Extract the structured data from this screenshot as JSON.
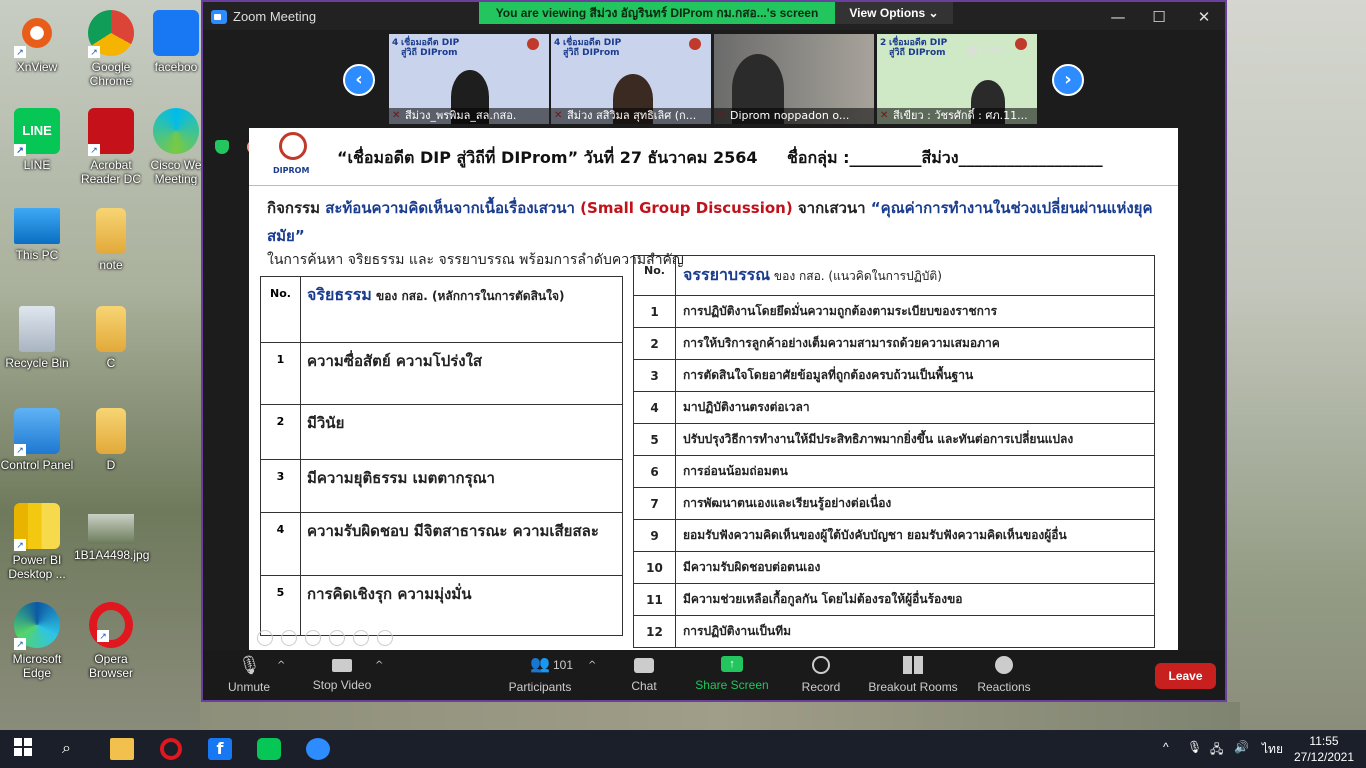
{
  "desktop": {
    "icons": [
      {
        "label": "XnView"
      },
      {
        "label": "Google Chrome"
      },
      {
        "label": "faceboo"
      },
      {
        "label": "LINE"
      },
      {
        "label": "Acrobat Reader DC"
      },
      {
        "label": "Cisco We Meeting"
      },
      {
        "label": "This PC"
      },
      {
        "label": "note"
      },
      {
        "label": "Recycle Bin"
      },
      {
        "label": "C"
      },
      {
        "label": "Control Panel"
      },
      {
        "label": "D"
      },
      {
        "label": "Power BI Desktop ..."
      },
      {
        "label": "1B1A4498.jpg"
      },
      {
        "label": "Microsoft Edge"
      },
      {
        "label": "Opera Browser"
      }
    ]
  },
  "zoom": {
    "window_title": "Zoom Meeting",
    "viewing_banner": "You are viewing สีม่วง อัญรินทร์ DIProm กม.กสอ...'s screen",
    "view_options": "View Options",
    "view_label": "View",
    "tiles": [
      {
        "name": "สีม่วง_พรพิมล_สล.กสอ.",
        "banner_num": "4",
        "banner": "เชื่อมอดีต DIP สู่วิถี DIProm"
      },
      {
        "name": "สีม่วง สสิวิมล สุทธิเลิศ (ก...",
        "banner_num": "4",
        "banner": "เชื่อมอดีต DIP สู่วิถี DIProm"
      },
      {
        "name": "Diprom noppadon o...",
        "banner_num": "",
        "banner": ""
      },
      {
        "name": "สีเขียว : วัชรศักดิ์ : ศภ.11...",
        "banner_num": "2",
        "banner": "เชื่อมอดีต DIP สู่วิถี DIProm"
      }
    ],
    "controls": {
      "unmute": "Unmute",
      "stop_video": "Stop Video",
      "participants": "Participants",
      "participants_count": "101",
      "chat": "Chat",
      "share_screen": "Share Screen",
      "record": "Record",
      "breakout_rooms": "Breakout Rooms",
      "reactions": "Reactions",
      "leave": "Leave"
    }
  },
  "slide": {
    "logo_text": "DIPROM",
    "title": "“เชื่อมอดีต DIP สู่วิถีที่ DIProm” วันที่ 27 ธันวาคม 2564",
    "group_label": "ชื่อกลุ่ม :_________สีม่วง__________________",
    "activity_prefix": "กิจกรรม",
    "activity_main": " สะท้อนความคิดเห็นจากเนื้อเรื่องเสวนา ",
    "activity_red": "(Small Group Discussion)",
    "activity_from": "  จากเสวนา ",
    "activity_topic": "“คุณค่าการทำงานในช่วงเปลี่ยนผ่านแห่งยุคสมัย”",
    "subtext": "ในการค้นหา จริยธรรม และ จรรยาบรรณ พร้อมการลำดับความสำคัญ",
    "ethics_table": {
      "no_header": "No.",
      "head_main": "จริยธรรม",
      "head_sub": " ของ กสอ. (หลักการในการตัดสินใจ)",
      "rows": [
        {
          "no": "1",
          "text": "ความซื่อสัตย์ ความโปร่งใส"
        },
        {
          "no": "2",
          "text": "มีวินัย"
        },
        {
          "no": "3",
          "text": "มีความยุติธรรม เมตตากรุณา"
        },
        {
          "no": "4",
          "text": "ความรับผิดชอบ มีจิตสาธารณะ ความเสียสละ"
        },
        {
          "no": "5",
          "text": "การคิดเชิงรุก ความมุ่งมั่น"
        }
      ]
    },
    "code_table": {
      "no_header": "No.",
      "head_main": "จรรยาบรรณ",
      "head_sub": " ของ กสอ. (แนวคิดในการปฏิบัติ)",
      "rows": [
        {
          "no": "1",
          "text": "การปฏิบัติงานโดยยึดมั่นความถูกต้องตามระเบียบของราชการ"
        },
        {
          "no": "2",
          "text": "การให้บริการลูกค้าอย่างเต็มความสามารถด้วยความเสมอภาค"
        },
        {
          "no": "3",
          "text": "การตัดสินใจโดยอาศัยข้อมูลที่ถูกต้องครบถ้วนเป็นพื้นฐาน"
        },
        {
          "no": "4",
          "text": "มาปฏิบัติงานตรงต่อเวลา"
        },
        {
          "no": "5",
          "text": "ปรับปรุงวิธีการทำงานให้มีประสิทธิภาพมากยิ่งขึ้น และทันต่อการเปลี่ยนแปลง"
        },
        {
          "no": "6",
          "text": "การอ่อนน้อมถ่อมตน"
        },
        {
          "no": "7",
          "text": "การพัฒนาตนเองและเรียนรู้อย่างต่อเนื่อง"
        },
        {
          "no": "9",
          "text": "ยอมรับฟังความคิดเห็นของผู้ใต้บังคับบัญชา ยอมรับฟังความคิดเห็นของผู้อื่น"
        },
        {
          "no": "10",
          "text": "มีความรับผิดชอบต่อตนเอง"
        },
        {
          "no": "11",
          "text": "มีความช่วยเหลือเกื้อกูลกัน โดยไม่ต้องรอให้ผู้อื่นร้องขอ"
        },
        {
          "no": "12",
          "text": "การปฏิบัติงานเป็นทีม"
        }
      ]
    }
  },
  "taskbar": {
    "language": "ไทย",
    "time": "11:55",
    "date": "27/12/2021"
  },
  "colors": {
    "zoom_accent": "#2d8cff",
    "share_green": "#22c55e",
    "leave_red": "#c8201e",
    "slide_blue": "#1a3c8f",
    "slide_red": "#c0121b"
  }
}
